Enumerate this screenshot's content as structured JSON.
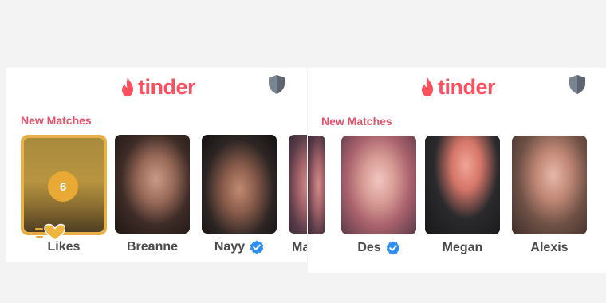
{
  "app": {
    "logo_text": "tinder",
    "brand_color": "#fd4f5d",
    "section_color": "#e8526c"
  },
  "left_panel": {
    "section_title": "New Matches",
    "likes": {
      "count": "6",
      "label": "Likes"
    },
    "matches": [
      {
        "name": "Breanne",
        "verified": false
      },
      {
        "name": "Nayy",
        "verified": true
      },
      {
        "name": "Ma",
        "verified": false
      }
    ]
  },
  "right_panel": {
    "section_title": "New Matches",
    "matches": [
      {
        "name": "Des",
        "verified": true
      },
      {
        "name": "Megan",
        "verified": false
      },
      {
        "name": "Alexis",
        "verified": false
      }
    ]
  },
  "icons": {
    "logo": "flame-icon",
    "safety": "shield-icon",
    "verified": "verified-badge-icon",
    "likes": "gold-heart-icon"
  }
}
